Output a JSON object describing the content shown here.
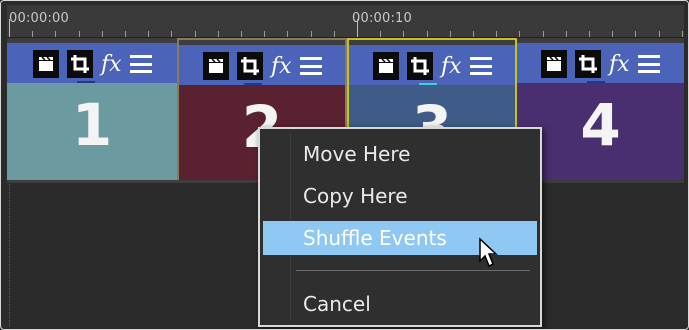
{
  "ruler": {
    "timecode_start": "00:00:00",
    "timecode_10": "00:00:10"
  },
  "events": [
    {
      "number": "1",
      "color": "#6b9aa0"
    },
    {
      "number": "2",
      "color": "#5a2230"
    },
    {
      "number": "3",
      "color": "#3f5c88"
    },
    {
      "number": "4",
      "color": "#4a2f70"
    }
  ],
  "icons": [
    "clapperboard-icon",
    "crop-icon",
    "fx-icon",
    "menu-icon"
  ],
  "icon_fx_text": "fx",
  "context_menu": {
    "items": [
      "Move Here",
      "Copy Here",
      "Shuffle Events",
      "Cancel"
    ],
    "highlighted": "Shuffle Events",
    "highlight_color": "#8fc8f2"
  }
}
